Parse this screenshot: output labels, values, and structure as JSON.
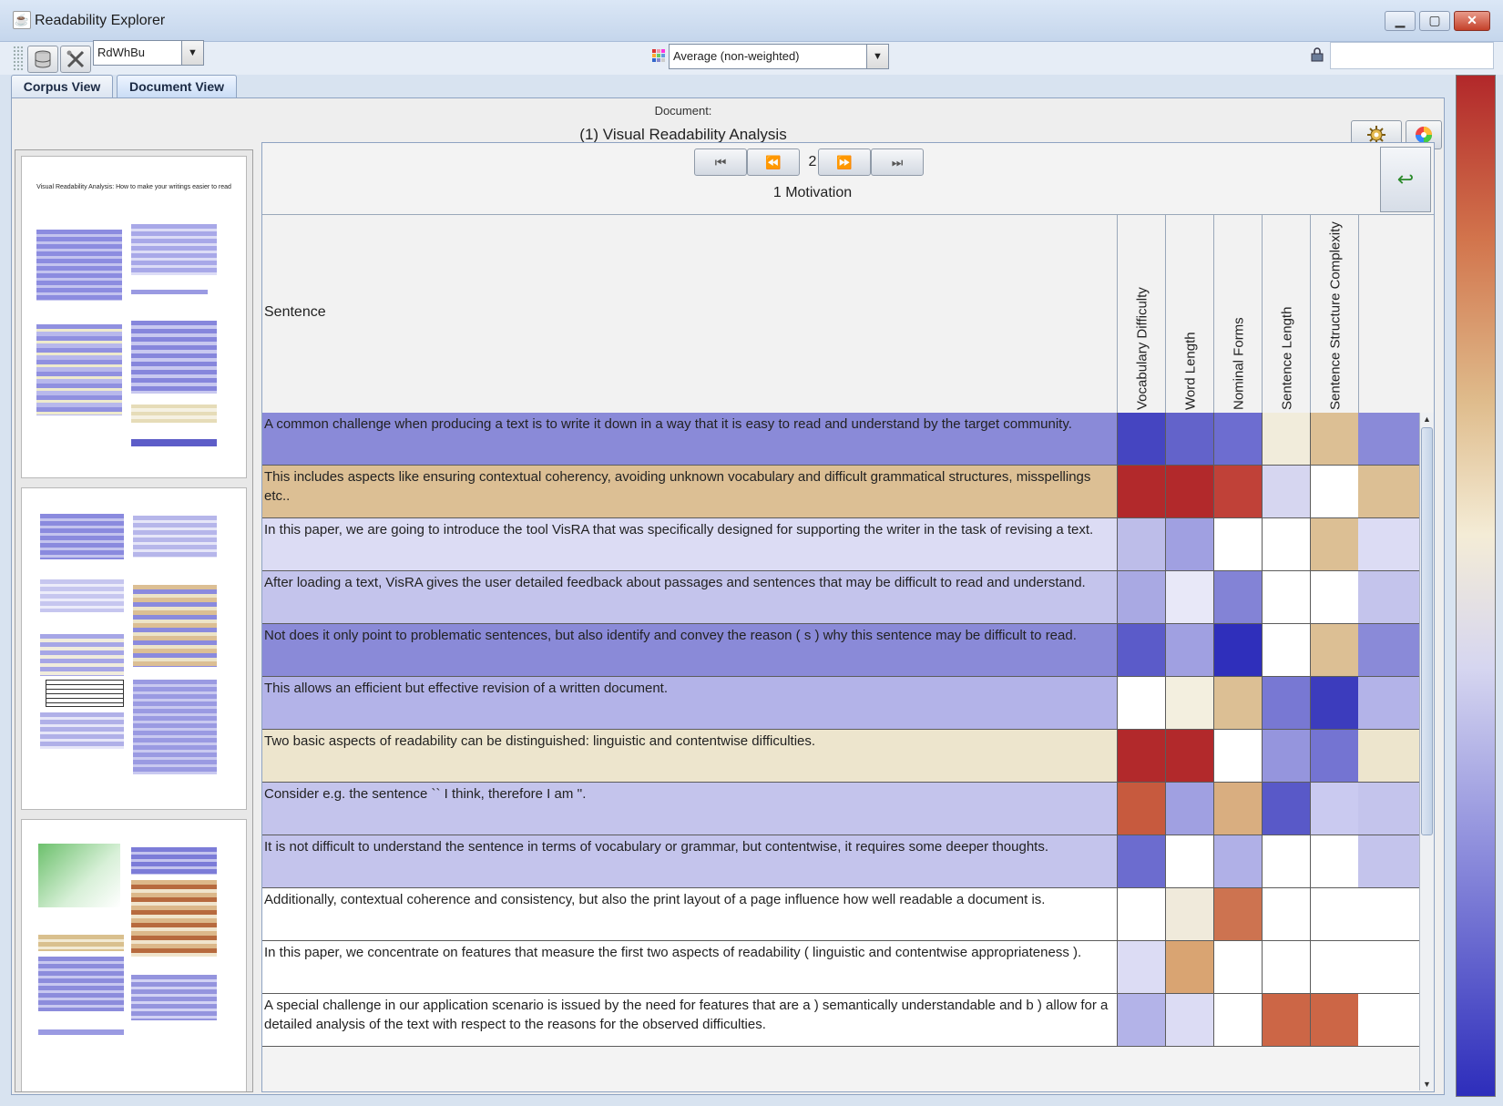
{
  "window": {
    "title": "Readability Explorer",
    "buttons": {
      "minimize": "▁",
      "maximize": "▢",
      "close": "✕"
    }
  },
  "toolbar": {
    "colormap": "RdWhBu",
    "aggregation": "Average (non-weighted)"
  },
  "tabs": [
    "Corpus View",
    "Document View"
  ],
  "document": {
    "label": "Document:",
    "title": "(1) Visual Readability Analysis"
  },
  "thumbnail": {
    "page1_title": "Visual Readability Analysis: How to make your writings easier to read"
  },
  "navigation": {
    "first": "⏮",
    "prev": "⏪",
    "page": "2",
    "next": "⏩",
    "last": "⏭",
    "section": "1 Motivation",
    "return_icon": "↩"
  },
  "table": {
    "sentence_header": "Sentence",
    "columns": [
      "Vocabulary Difficulty",
      "Word Length",
      "Nominal Forms",
      "Sentence Length",
      "Sentence Structure Complexity"
    ],
    "rows": [
      {
        "text": "A common challenge when producing a text is to write it down in a way that it is easy to read and understand by the target community.",
        "bg": "#8a8ad8",
        "cells": [
          "#4545c1",
          "#6363ca",
          "#6d6dd0",
          "#f1ecdb",
          "#dcbf94"
        ]
      },
      {
        "text": "This includes aspects like ensuring contextual coherency, avoiding unknown vocabulary and difficult grammatical structures, misspellings etc..",
        "bg": "#dcbf94",
        "cells": [
          "#b2292b",
          "#b2292b",
          "#c04138",
          "#d6d6f0",
          "#ffffff"
        ]
      },
      {
        "text": "In this paper, we are going to introduce the tool VisRA that was specifically designed for supporting the writer in the task of revising a text.",
        "bg": "#dcdcf4",
        "cells": [
          "#bdbde9",
          "#a0a0e1",
          "#ffffff",
          "#ffffff",
          "#dcbf94"
        ]
      },
      {
        "text": "After loading a text, VisRA gives the user detailed feedback about passages and sentences that may be difficult to read and understand.",
        "bg": "#c4c4ec",
        "cells": [
          "#a9a9e3",
          "#e8e8f8",
          "#8383d6",
          "#ffffff",
          "#ffffff"
        ]
      },
      {
        "text": "Not does it only point to problematic sentences, but also identify and convey the reason ( s ) why this sentence may be difficult to read.",
        "bg": "#8a8ad8",
        "cells": [
          "#5b5bc9",
          "#a0a0e1",
          "#2f2fbb",
          "#ffffff",
          "#dcbf94"
        ]
      },
      {
        "text": "This allows an efficient but effective revision of a written document.",
        "bg": "#b3b3e8",
        "cells": [
          "#ffffff",
          "#f3efdf",
          "#dcbf94",
          "#7878d3",
          "#3c3cbd"
        ]
      },
      {
        "text": "Two basic aspects of readability can be distinguished: linguistic and contentwise difficulties.",
        "bg": "#ede5cd",
        "cells": [
          "#b2292b",
          "#b2292b",
          "#ffffff",
          "#9595dd",
          "#7474d2"
        ]
      },
      {
        "text": "Consider e.g. the sentence `` I think, therefore I am ''.",
        "bg": "#c4c4ec",
        "cells": [
          "#c75a3e",
          "#a0a0e1",
          "#d9ae80",
          "#5959c8",
          "#cacaf0"
        ]
      },
      {
        "text": "It is not difficult to understand the sentence in terms of vocabulary or grammar, but contentwise, it requires some deeper thoughts.",
        "bg": "#c4c4ec",
        "cells": [
          "#6c6ccf",
          "#ffffff",
          "#b0b0e7",
          "#ffffff",
          "#ffffff"
        ]
      },
      {
        "text": "Additionally, contextual coherence and consistency, but also the print layout of a page influence how well readable a document is.",
        "bg": "#ffffff",
        "cells": [
          "#ffffff",
          "#f0eadb",
          "#cd7350",
          "#ffffff",
          "#ffffff"
        ]
      },
      {
        "text": "In this paper, we concentrate on features that measure the first two aspects of readability ( linguistic and contentwise appropriateness ).",
        "bg": "#ffffff",
        "cells": [
          "#dcdcf4",
          "#d9a472",
          "#ffffff",
          "#ffffff",
          "#ffffff"
        ]
      },
      {
        "text": "A special challenge in our application scenario is issued by the need for features that are a ) semantically understandable and b ) allow for a detailed analysis of the text with respect to the reasons for the observed difficulties.",
        "bg": "#ffffff",
        "cells": [
          "#b3b3e8",
          "#dcdcf4",
          "#ffffff",
          "#cc6646",
          "#cc6646"
        ]
      }
    ]
  },
  "colors": {
    "high": "#b2282a",
    "mid": "#f4ecd6",
    "low": "#2d2dbb"
  }
}
